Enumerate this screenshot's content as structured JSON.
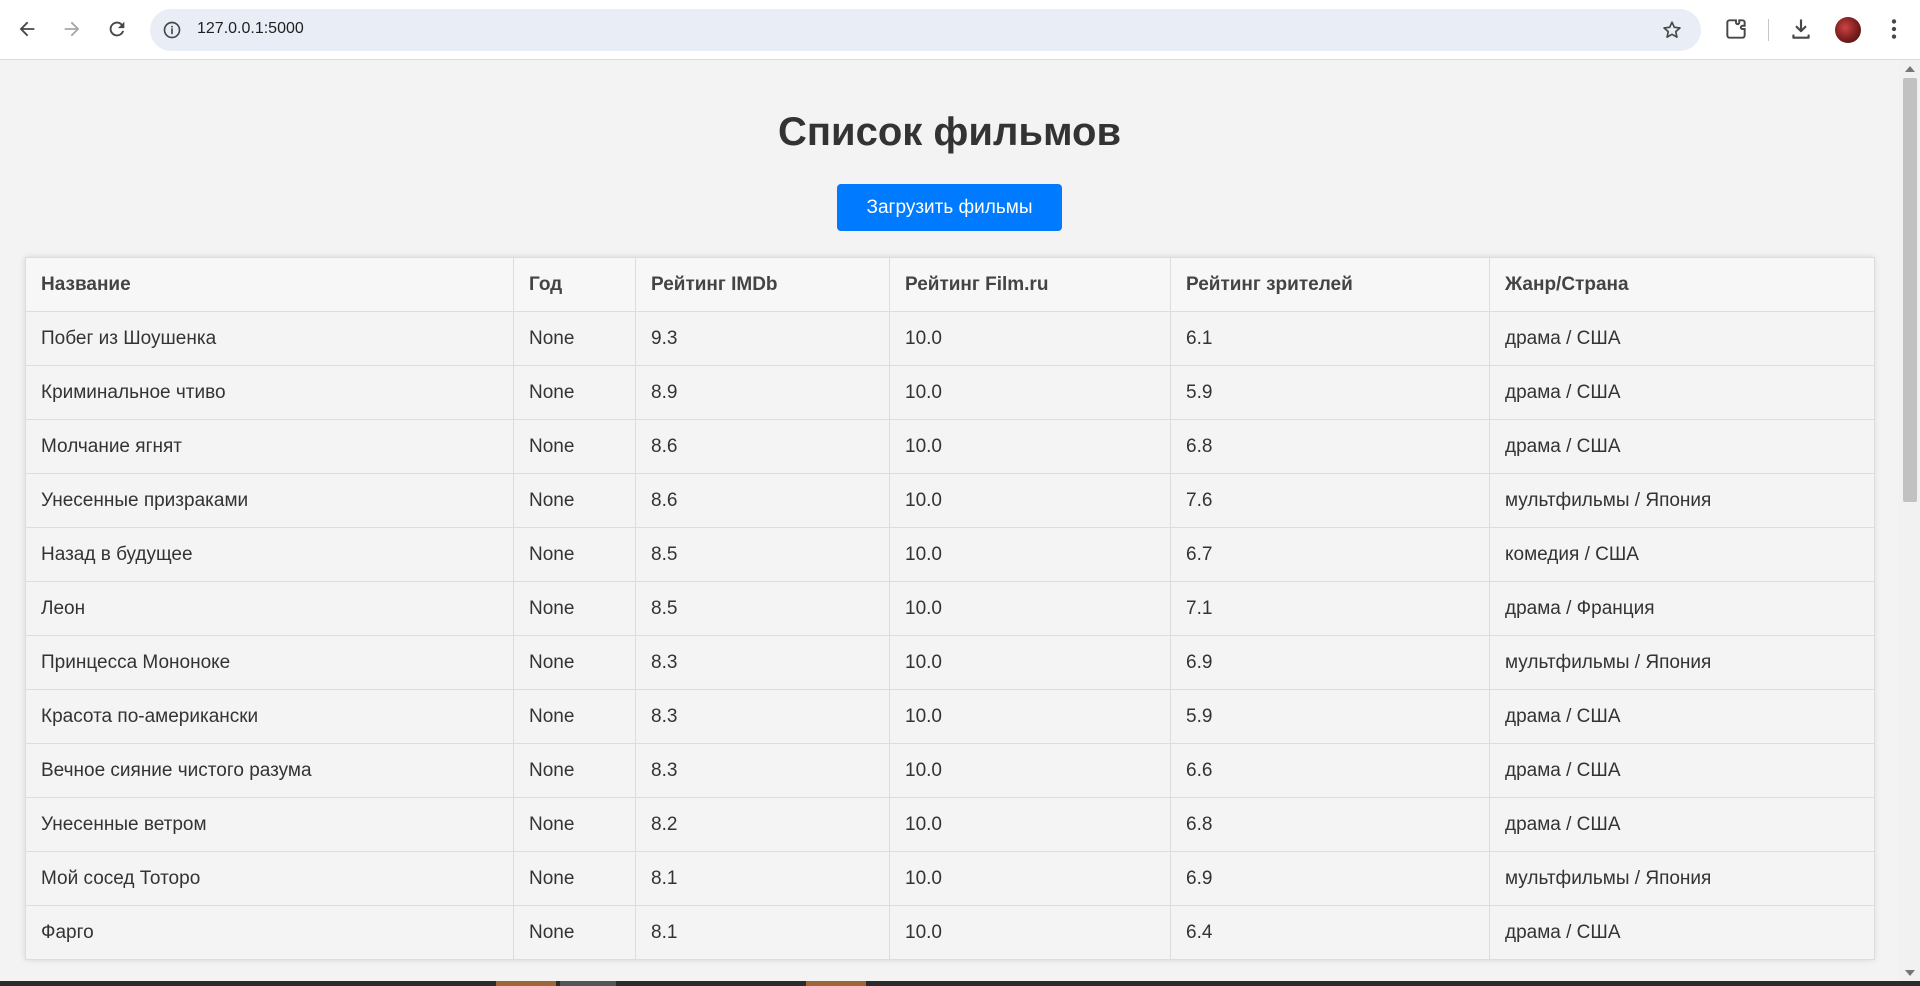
{
  "browser": {
    "url": "127.0.0.1:5000",
    "icons": [
      "back-icon",
      "forward-icon",
      "reload-icon",
      "site-info-icon",
      "bookmark-star-icon",
      "extensions-icon",
      "download-icon",
      "avatar",
      "menu-icon"
    ]
  },
  "page": {
    "title": "Список фильмов",
    "load_button": "Загрузить фильмы",
    "accent_color": "#007bff"
  },
  "table": {
    "headers": [
      "Название",
      "Год",
      "Рейтинг IMDb",
      "Рейтинг Film.ru",
      "Рейтинг зрителей",
      "Жанр/Страна"
    ],
    "rows": [
      [
        "Побег из Шоушенка",
        "None",
        "9.3",
        "10.0",
        "6.1",
        "драма / США"
      ],
      [
        "Криминальное чтиво",
        "None",
        "8.9",
        "10.0",
        "5.9",
        "драма / США"
      ],
      [
        "Молчание ягнят",
        "None",
        "8.6",
        "10.0",
        "6.8",
        "драма / США"
      ],
      [
        "Унесенные призраками",
        "None",
        "8.6",
        "10.0",
        "7.6",
        "мультфильмы / Япония"
      ],
      [
        "Назад в будущее",
        "None",
        "8.5",
        "10.0",
        "6.7",
        "комедия / США"
      ],
      [
        "Леон",
        "None",
        "8.5",
        "10.0",
        "7.1",
        "драма / Франция"
      ],
      [
        "Принцесса Мононоке",
        "None",
        "8.3",
        "10.0",
        "6.9",
        "мультфильмы / Япония"
      ],
      [
        "Красота по-американски",
        "None",
        "8.3",
        "10.0",
        "5.9",
        "драма / США"
      ],
      [
        "Вечное сияние чистого разума",
        "None",
        "8.3",
        "10.0",
        "6.6",
        "драма / США"
      ],
      [
        "Унесенные ветром",
        "None",
        "8.2",
        "10.0",
        "6.8",
        "драма / США"
      ],
      [
        "Мой сосед Тоторо",
        "None",
        "8.1",
        "10.0",
        "6.9",
        "мультфильмы / Япония"
      ],
      [
        "Фарго",
        "None",
        "8.1",
        "10.0",
        "6.4",
        "драма / США"
      ]
    ]
  }
}
